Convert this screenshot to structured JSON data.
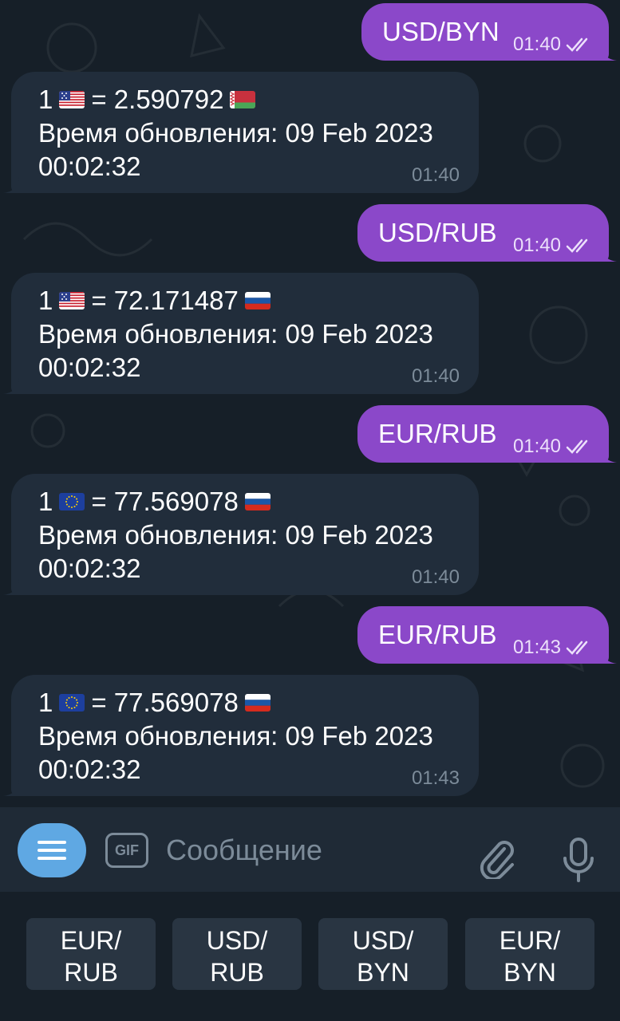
{
  "colors": {
    "outgoing_bubble": "#8b48c9",
    "incoming_bubble": "#212d3b",
    "background": "#161f28",
    "accent": "#5fa8e3"
  },
  "messages": [
    {
      "type": "outgoing",
      "text": "USD/BYN",
      "time": "01:40",
      "status": "read"
    },
    {
      "type": "incoming",
      "amount": "1",
      "from_flag": "us-flag-icon",
      "rate": "= 2.590792",
      "to_flag": "by-flag-icon",
      "update_label": "Время обновления: 09 Feb 2023",
      "update_time": "00:02:32",
      "time": "01:40"
    },
    {
      "type": "outgoing",
      "text": "USD/RUB",
      "time": "01:40",
      "status": "read"
    },
    {
      "type": "incoming",
      "amount": "1",
      "from_flag": "us-flag-icon",
      "rate": "= 72.171487",
      "to_flag": "ru-flag-icon",
      "update_label": "Время обновления: 09 Feb 2023",
      "update_time": "00:02:32",
      "time": "01:40"
    },
    {
      "type": "outgoing",
      "text": "EUR/RUB",
      "time": "01:40",
      "status": "read"
    },
    {
      "type": "incoming",
      "amount": "1",
      "from_flag": "eu-flag-icon",
      "rate": "= 77.569078",
      "to_flag": "ru-flag-icon",
      "update_label": "Время обновления: 09 Feb 2023",
      "update_time": "00:02:32",
      "time": "01:40"
    },
    {
      "type": "outgoing",
      "text": "EUR/RUB",
      "time": "01:43",
      "status": "read"
    },
    {
      "type": "incoming",
      "amount": "1",
      "from_flag": "eu-flag-icon",
      "rate": "= 77.569078",
      "to_flag": "ru-flag-icon",
      "update_label": "Время обновления: 09 Feb 2023",
      "update_time": "00:02:32",
      "time": "01:43"
    }
  ],
  "input": {
    "placeholder": "Сообщение",
    "gif_label": "GIF",
    "icons": [
      "menu-icon",
      "gif-icon",
      "paperclip-icon",
      "microphone-icon"
    ]
  },
  "keyboard": [
    {
      "line1": "EUR/",
      "line2": "RUB"
    },
    {
      "line1": "USD/",
      "line2": "RUB"
    },
    {
      "line1": "USD/",
      "line2": "BYN"
    },
    {
      "line1": "EUR/",
      "line2": "BYN"
    }
  ]
}
